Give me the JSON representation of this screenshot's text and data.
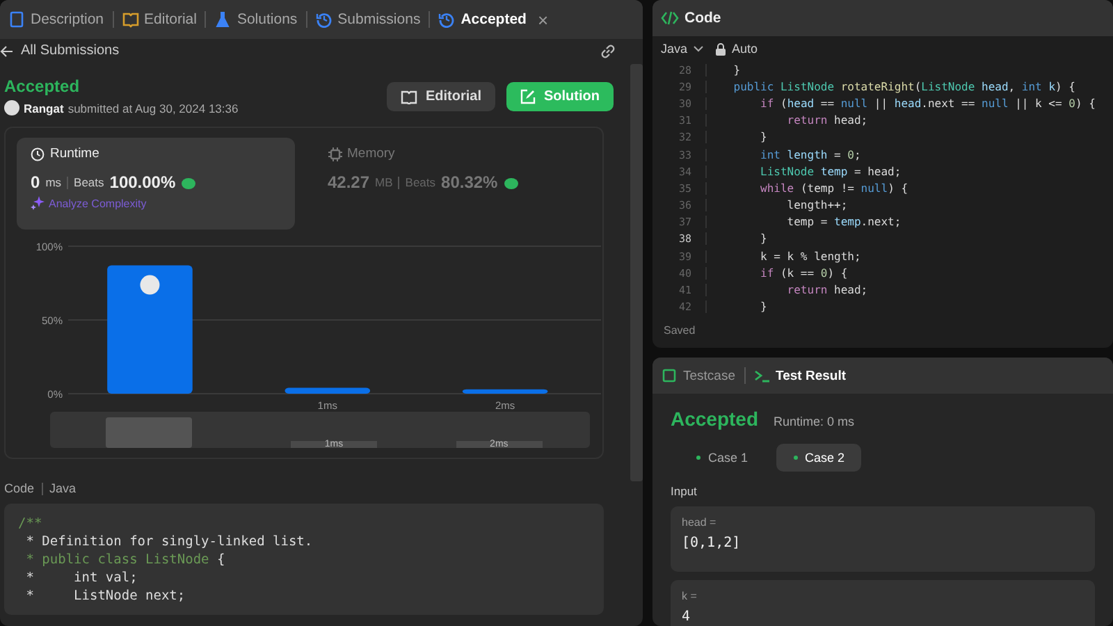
{
  "left_panel": {
    "tabs": [
      {
        "label": "Description",
        "selected": false
      },
      {
        "label": "Editorial",
        "selected": false
      },
      {
        "label": "Solutions",
        "selected": false
      },
      {
        "label": "Submissions",
        "selected": false
      },
      {
        "label": "Accepted",
        "selected": true,
        "close": "×"
      }
    ],
    "back_link": "All Submissions",
    "submission": {
      "status": "Accepted",
      "user": "Rangat",
      "submitted": "submitted at Aug 30, 2024 13:36"
    },
    "buttons": [
      {
        "label": "Editorial",
        "kind": "secondary"
      },
      {
        "label": "Solution",
        "kind": "primary"
      }
    ],
    "stats": [
      {
        "title": "Runtime",
        "value": "0",
        "unit": "ms",
        "beats_label": "Beats",
        "beats": "100.00%",
        "selected": true,
        "action": "Analyze Complexity"
      },
      {
        "title": "Memory",
        "value": "42.27",
        "unit": "MB",
        "beats_label": "Beats",
        "beats": "80.32%",
        "selected": false
      }
    ],
    "chart_data": {
      "type": "bar",
      "categories": [
        null,
        "1ms",
        "2ms"
      ],
      "values": [
        87,
        4,
        3
      ],
      "ylim": [
        0,
        100
      ],
      "yticks": [
        {
          "value": 0,
          "label": "0%"
        },
        {
          "value": 50,
          "label": "50%"
        },
        {
          "value": 100,
          "label": "100%"
        }
      ]
    },
    "navigator_labels": [
      "1ms",
      "2ms"
    ],
    "code_header": {
      "title": "Code",
      "language": "Java"
    },
    "code": [
      [
        {
          "kind": "comment",
          "t": "/**"
        }
      ],
      [
        {
          "kind": "plain",
          "t": " * Definition for singly-linked list."
        }
      ],
      [
        {
          "kind": "comment",
          "t": " * public class ListNode "
        },
        {
          "kind": "plain",
          "t": "{"
        }
      ],
      [
        {
          "kind": "plain",
          "t": " *     int val;"
        }
      ],
      [
        {
          "kind": "plain",
          "t": " *     ListNode next;"
        }
      ]
    ]
  },
  "editor": {
    "title": "Code",
    "language": "Java",
    "mode": "Auto",
    "status": "Saved",
    "lines": [
      {
        "n": "28",
        "current": false,
        "s": [
          {
            "kind": "plain",
            "t": "    }"
          }
        ]
      },
      {
        "n": "29",
        "current": false,
        "s": [
          {
            "kind": "keyword",
            "t": "    public "
          },
          {
            "kind": "type",
            "t": "ListNode "
          },
          {
            "kind": "function",
            "t": "rotateRight"
          },
          {
            "kind": "plain",
            "t": "("
          },
          {
            "kind": "type",
            "t": "ListNode "
          },
          {
            "kind": "variable",
            "t": "head"
          },
          {
            "kind": "plain",
            "t": ", "
          },
          {
            "kind": "keyword",
            "t": "int "
          },
          {
            "kind": "variable",
            "t": "k"
          },
          {
            "kind": "plain",
            "t": ") {"
          }
        ]
      },
      {
        "n": "30",
        "current": false,
        "s": [
          {
            "kind": "control",
            "t": "        if "
          },
          {
            "kind": "plain",
            "t": "("
          },
          {
            "kind": "variable",
            "t": "head"
          },
          {
            "kind": "plain",
            "t": " == "
          },
          {
            "kind": "keyword",
            "t": "null"
          },
          {
            "kind": "plain",
            "t": " || "
          },
          {
            "kind": "variable",
            "t": "head"
          },
          {
            "kind": "plain",
            "t": ".next == "
          },
          {
            "kind": "keyword",
            "t": "null"
          },
          {
            "kind": "plain",
            "t": " || k <= "
          },
          {
            "kind": "number",
            "t": "0"
          },
          {
            "kind": "plain",
            "t": ") {"
          }
        ]
      },
      {
        "n": "31",
        "current": false,
        "s": [
          {
            "kind": "control",
            "t": "            return "
          },
          {
            "kind": "plain",
            "t": "head;"
          }
        ]
      },
      {
        "n": "32",
        "current": false,
        "s": [
          {
            "kind": "plain",
            "t": "        }"
          }
        ]
      },
      {
        "n": "33",
        "current": false,
        "s": [
          {
            "kind": "keyword",
            "t": "        int "
          },
          {
            "kind": "variable",
            "t": "length"
          },
          {
            "kind": "plain",
            "t": " = "
          },
          {
            "kind": "number",
            "t": "0"
          },
          {
            "kind": "plain",
            "t": ";"
          }
        ]
      },
      {
        "n": "34",
        "current": false,
        "s": [
          {
            "kind": "type",
            "t": "        ListNode "
          },
          {
            "kind": "variable",
            "t": "temp"
          },
          {
            "kind": "plain",
            "t": " = head;"
          }
        ]
      },
      {
        "n": "35",
        "current": false,
        "s": [
          {
            "kind": "control",
            "t": "        while "
          },
          {
            "kind": "plain",
            "t": "(temp != "
          },
          {
            "kind": "keyword",
            "t": "null"
          },
          {
            "kind": "plain",
            "t": ") {"
          }
        ]
      },
      {
        "n": "36",
        "current": false,
        "s": [
          {
            "kind": "plain",
            "t": "            length++;"
          }
        ]
      },
      {
        "n": "37",
        "current": false,
        "s": [
          {
            "kind": "plain",
            "t": "            temp = "
          },
          {
            "kind": "variable",
            "t": "temp"
          },
          {
            "kind": "plain",
            "t": ".next;"
          }
        ]
      },
      {
        "n": "38",
        "current": true,
        "s": [
          {
            "kind": "plain",
            "t": "        }"
          }
        ]
      },
      {
        "n": "39",
        "current": false,
        "s": [
          {
            "kind": "plain",
            "t": "        k = k % length;"
          }
        ]
      },
      {
        "n": "40",
        "current": false,
        "s": [
          {
            "kind": "control",
            "t": "        if "
          },
          {
            "kind": "plain",
            "t": "(k == "
          },
          {
            "kind": "number",
            "t": "0"
          },
          {
            "kind": "plain",
            "t": ") {"
          }
        ]
      },
      {
        "n": "41",
        "current": false,
        "s": [
          {
            "kind": "control",
            "t": "            return "
          },
          {
            "kind": "plain",
            "t": "head;"
          }
        ]
      },
      {
        "n": "42",
        "current": false,
        "s": [
          {
            "kind": "plain",
            "t": "        }"
          }
        ]
      }
    ]
  },
  "result_panel": {
    "tabs": [
      {
        "label": "Testcase",
        "selected": false
      },
      {
        "label": "Test Result",
        "selected": true
      }
    ],
    "status": "Accepted",
    "runtime": "Runtime: 0 ms",
    "cases": [
      {
        "label": "Case 1",
        "selected": false
      },
      {
        "label": "Case 2",
        "selected": true
      }
    ],
    "input_label": "Input",
    "inputs": [
      {
        "name": "head =",
        "value": "[0,1,2]"
      },
      {
        "name": "k =",
        "value": "4"
      }
    ]
  }
}
